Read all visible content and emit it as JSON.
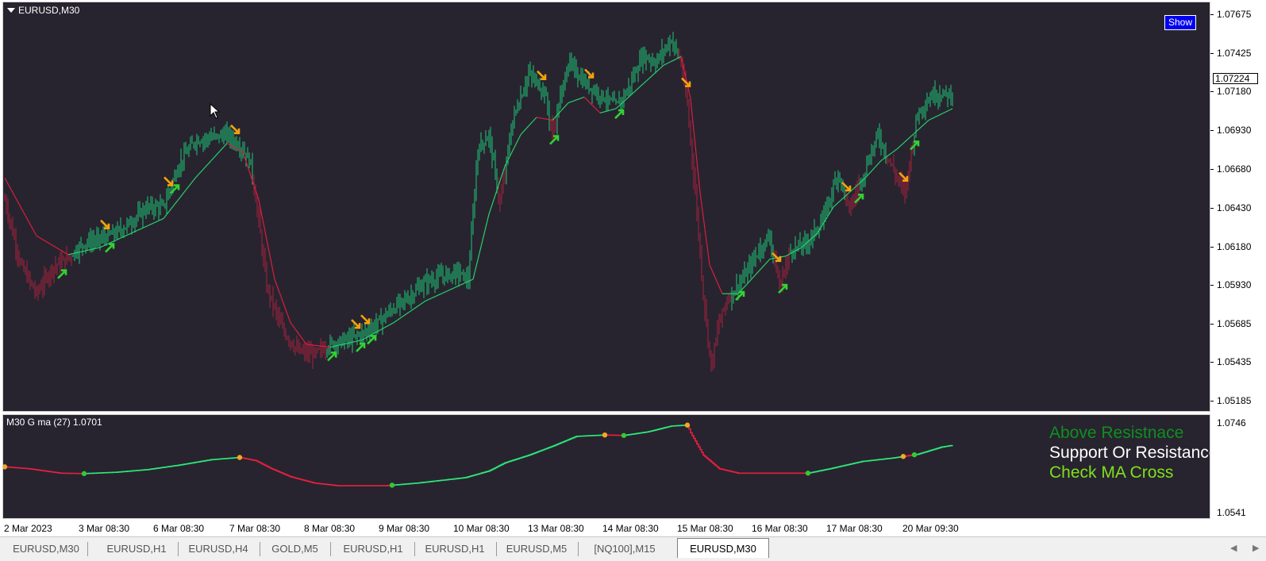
{
  "window": {
    "main_title": "EURUSD,M30",
    "show_button": "Show",
    "indicator_title": "M30 G ma (27) 1.0701",
    "current_price": "1.07224"
  },
  "price_scale": {
    "main_labels": [
      "1.07675",
      "1.07425",
      "1.07180",
      "1.06930",
      "1.06680",
      "1.06430",
      "1.06180",
      "1.05930",
      "1.05685",
      "1.05435",
      "1.05185"
    ],
    "sub_labels": [
      "1.0746",
      "1.0541"
    ]
  },
  "time_axis": [
    "2 Mar 2023",
    "3 Mar 08:30",
    "6 Mar 08:30",
    "7 Mar 08:30",
    "8 Mar 08:30",
    "9 Mar 08:30",
    "10 Mar 08:30",
    "13 Mar 08:30",
    "14 Mar 08:30",
    "15 Mar 08:30",
    "16 Mar 08:30",
    "17 Mar 08:30",
    "20 Mar 09:30"
  ],
  "legend": [
    {
      "text": "Above Resistnace",
      "color": "#0f8f1f"
    },
    {
      "text": "Support Or Resistance",
      "color": "#ffffff"
    },
    {
      "text": "Check MA Cross",
      "color": "#7fe01a"
    }
  ],
  "tabs": [
    "EURUSD,M30",
    "EURUSD,H1",
    "EURUSD,H4",
    "GOLD,M5",
    "EURUSD,H1",
    "EURUSD,H1",
    "EURUSD,M5",
    "[NQ100],M15",
    "EURUSD,M30"
  ],
  "active_tab_index": 8,
  "colors": {
    "background": "#27242f",
    "bull_bar": "#1ec677",
    "bear_bar": "#a8203c",
    "ma_up": "#27d36a",
    "ma_down": "#dc1e3c",
    "signal_up_arrow": "#33d233",
    "signal_down_arrow": "#f5a20a",
    "indicator_up": "#2ee87a",
    "indicator_down": "#e8203f",
    "dot_orange": "#f5a623",
    "dot_green": "#35c835"
  },
  "chart_data": {
    "type": "candlestick",
    "symbol": "EURUSD",
    "timeframe": "M30",
    "ylim": [
      1.0506,
      1.0776
    ],
    "x_range_bars": [
      0,
      600
    ],
    "date_ticks_bar_index": [
      0,
      47,
      94,
      142,
      189,
      236,
      283,
      330,
      377,
      424,
      471,
      518,
      566
    ],
    "price_path": [
      [
        0,
        1.0645
      ],
      [
        10,
        1.06
      ],
      [
        20,
        1.058
      ],
      [
        30,
        1.0598
      ],
      [
        40,
        1.0605
      ],
      [
        50,
        1.0615
      ],
      [
        60,
        1.0618
      ],
      [
        70,
        1.0622
      ],
      [
        80,
        1.063
      ],
      [
        90,
        1.064
      ],
      [
        100,
        1.064
      ],
      [
        110,
        1.067
      ],
      [
        120,
        1.0686
      ],
      [
        130,
        1.0688
      ],
      [
        140,
        1.069
      ],
      [
        150,
        1.068
      ],
      [
        155,
        1.067
      ],
      [
        160,
        1.063
      ],
      [
        165,
        1.0585
      ],
      [
        175,
        1.0555
      ],
      [
        185,
        1.054
      ],
      [
        195,
        1.0538
      ],
      [
        205,
        1.0545
      ],
      [
        215,
        1.0548
      ],
      [
        225,
        1.0552
      ],
      [
        235,
        1.056
      ],
      [
        245,
        1.057
      ],
      [
        255,
        1.0578
      ],
      [
        265,
        1.0588
      ],
      [
        275,
        1.0592
      ],
      [
        285,
        1.0595
      ],
      [
        292,
        1.059
      ],
      [
        298,
        1.068
      ],
      [
        305,
        1.069
      ],
      [
        312,
        1.0642
      ],
      [
        320,
        1.07
      ],
      [
        330,
        1.0732
      ],
      [
        340,
        1.072
      ],
      [
        345,
        1.069
      ],
      [
        355,
        1.074
      ],
      [
        365,
        1.0726
      ],
      [
        375,
        1.0718
      ],
      [
        385,
        1.071
      ],
      [
        392,
        1.072
      ],
      [
        402,
        1.0745
      ],
      [
        410,
        1.074
      ],
      [
        420,
        1.0756
      ],
      [
        426,
        1.074
      ],
      [
        430,
        1.071
      ],
      [
        435,
        1.065
      ],
      [
        440,
        1.058
      ],
      [
        445,
        1.053
      ],
      [
        450,
        1.056
      ],
      [
        455,
        1.0576
      ],
      [
        465,
        1.059
      ],
      [
        475,
        1.061
      ],
      [
        482,
        1.062
      ],
      [
        488,
        1.0585
      ],
      [
        495,
        1.061
      ],
      [
        505,
        1.0615
      ],
      [
        515,
        1.063
      ],
      [
        525,
        1.0664
      ],
      [
        532,
        1.0638
      ],
      [
        540,
        1.066
      ],
      [
        550,
        1.069
      ],
      [
        560,
        1.0665
      ],
      [
        567,
        1.065
      ],
      [
        575,
        1.0705
      ],
      [
        585,
        1.0718
      ],
      [
        597,
        1.0718
      ]
    ],
    "ma_path": [
      [
        0,
        1.066
      ],
      [
        20,
        1.062
      ],
      [
        40,
        1.0607
      ],
      [
        60,
        1.0612
      ],
      [
        80,
        1.0622
      ],
      [
        100,
        1.0632
      ],
      [
        120,
        1.066
      ],
      [
        140,
        1.0684
      ],
      [
        150,
        1.0678
      ],
      [
        160,
        1.0645
      ],
      [
        170,
        1.059
      ],
      [
        180,
        1.056
      ],
      [
        190,
        1.0545
      ],
      [
        205,
        1.0543
      ],
      [
        225,
        1.0548
      ],
      [
        245,
        1.056
      ],
      [
        265,
        1.0575
      ],
      [
        285,
        1.0585
      ],
      [
        295,
        1.059
      ],
      [
        305,
        1.0635
      ],
      [
        315,
        1.0668
      ],
      [
        325,
        1.069
      ],
      [
        335,
        1.0702
      ],
      [
        345,
        1.07
      ],
      [
        355,
        1.0712
      ],
      [
        365,
        1.0716
      ],
      [
        375,
        1.0705
      ],
      [
        385,
        1.0708
      ],
      [
        395,
        1.0718
      ],
      [
        405,
        1.0728
      ],
      [
        415,
        1.0738
      ],
      [
        426,
        1.0744
      ],
      [
        432,
        1.0715
      ],
      [
        438,
        1.065
      ],
      [
        444,
        1.06
      ],
      [
        452,
        1.058
      ],
      [
        462,
        1.058
      ],
      [
        472,
        1.0592
      ],
      [
        482,
        1.0604
      ],
      [
        492,
        1.0606
      ],
      [
        502,
        1.0612
      ],
      [
        512,
        1.0622
      ],
      [
        522,
        1.064
      ],
      [
        532,
        1.065
      ],
      [
        542,
        1.066
      ],
      [
        552,
        1.0672
      ],
      [
        562,
        1.068
      ],
      [
        572,
        1.069
      ],
      [
        582,
        1.07
      ],
      [
        597,
        1.0708
      ]
    ],
    "signals": [
      {
        "bar": 36,
        "dir": "up"
      },
      {
        "bar": 63,
        "dir": "down"
      },
      {
        "bar": 66,
        "dir": "up"
      },
      {
        "bar": 103,
        "dir": "down"
      },
      {
        "bar": 107,
        "dir": "up"
      },
      {
        "bar": 145,
        "dir": "down"
      },
      {
        "bar": 206,
        "dir": "up"
      },
      {
        "bar": 221,
        "dir": "down"
      },
      {
        "bar": 224,
        "dir": "up"
      },
      {
        "bar": 227,
        "dir": "down"
      },
      {
        "bar": 231,
        "dir": "up"
      },
      {
        "bar": 338,
        "dir": "down"
      },
      {
        "bar": 346,
        "dir": "up"
      },
      {
        "bar": 368,
        "dir": "down"
      },
      {
        "bar": 387,
        "dir": "up"
      },
      {
        "bar": 429,
        "dir": "down"
      },
      {
        "bar": 463,
        "dir": "up"
      },
      {
        "bar": 486,
        "dir": "down"
      },
      {
        "bar": 490,
        "dir": "up"
      },
      {
        "bar": 530,
        "dir": "down"
      },
      {
        "bar": 538,
        "dir": "up"
      },
      {
        "bar": 566,
        "dir": "down"
      },
      {
        "bar": 573,
        "dir": "up"
      }
    ],
    "indicator": {
      "name": "M30 G ma (27)",
      "value": 1.0701,
      "ylim": [
        1.0541,
        1.0746
      ],
      "path": [
        [
          0,
          1.0634
        ],
        [
          15,
          1.063
        ],
        [
          25,
          1.0625
        ],
        [
          35,
          1.062
        ],
        [
          50,
          1.0619
        ],
        [
          70,
          1.0622
        ],
        [
          90,
          1.0628
        ],
        [
          110,
          1.0638
        ],
        [
          130,
          1.065
        ],
        [
          148,
          1.0655
        ],
        [
          158,
          1.0648
        ],
        [
          168,
          1.063
        ],
        [
          180,
          1.0612
        ],
        [
          195,
          1.0598
        ],
        [
          210,
          1.0592
        ],
        [
          240,
          1.0592
        ],
        [
          260,
          1.0598
        ],
        [
          290,
          1.061
        ],
        [
          305,
          1.0625
        ],
        [
          315,
          1.0643
        ],
        [
          330,
          1.066
        ],
        [
          345,
          1.068
        ],
        [
          360,
          1.0702
        ],
        [
          378,
          1.0705
        ],
        [
          390,
          1.0704
        ],
        [
          405,
          1.0712
        ],
        [
          420,
          1.0725
        ],
        [
          430,
          1.0727
        ],
        [
          432,
          1.071
        ],
        [
          440,
          1.066
        ],
        [
          450,
          1.063
        ],
        [
          462,
          1.062
        ],
        [
          480,
          1.062
        ],
        [
          506,
          1.062
        ],
        [
          520,
          1.063
        ],
        [
          540,
          1.0646
        ],
        [
          560,
          1.0654
        ],
        [
          575,
          1.0662
        ],
        [
          590,
          1.0678
        ],
        [
          597,
          1.0682
        ]
      ],
      "segments": [
        {
          "from": 0,
          "to": 50,
          "dir": "down"
        },
        {
          "from": 50,
          "to": 148,
          "dir": "up"
        },
        {
          "from": 148,
          "to": 244,
          "dir": "down"
        },
        {
          "from": 244,
          "to": 378,
          "dir": "up"
        },
        {
          "from": 378,
          "to": 390,
          "dir": "down"
        },
        {
          "from": 390,
          "to": 430,
          "dir": "up"
        },
        {
          "from": 430,
          "to": 506,
          "dir": "down"
        },
        {
          "from": 506,
          "to": 566,
          "dir": "up"
        },
        {
          "from": 566,
          "to": 573,
          "dir": "down"
        },
        {
          "from": 573,
          "to": 597,
          "dir": "up"
        }
      ],
      "dots": [
        {
          "bar": 0,
          "color": "orange"
        },
        {
          "bar": 50,
          "color": "green"
        },
        {
          "bar": 148,
          "color": "orange"
        },
        {
          "bar": 244,
          "color": "green"
        },
        {
          "bar": 378,
          "color": "orange"
        },
        {
          "bar": 390,
          "color": "green"
        },
        {
          "bar": 430,
          "color": "orange"
        },
        {
          "bar": 506,
          "color": "green"
        },
        {
          "bar": 566,
          "color": "orange"
        },
        {
          "bar": 573,
          "color": "green"
        }
      ]
    }
  }
}
